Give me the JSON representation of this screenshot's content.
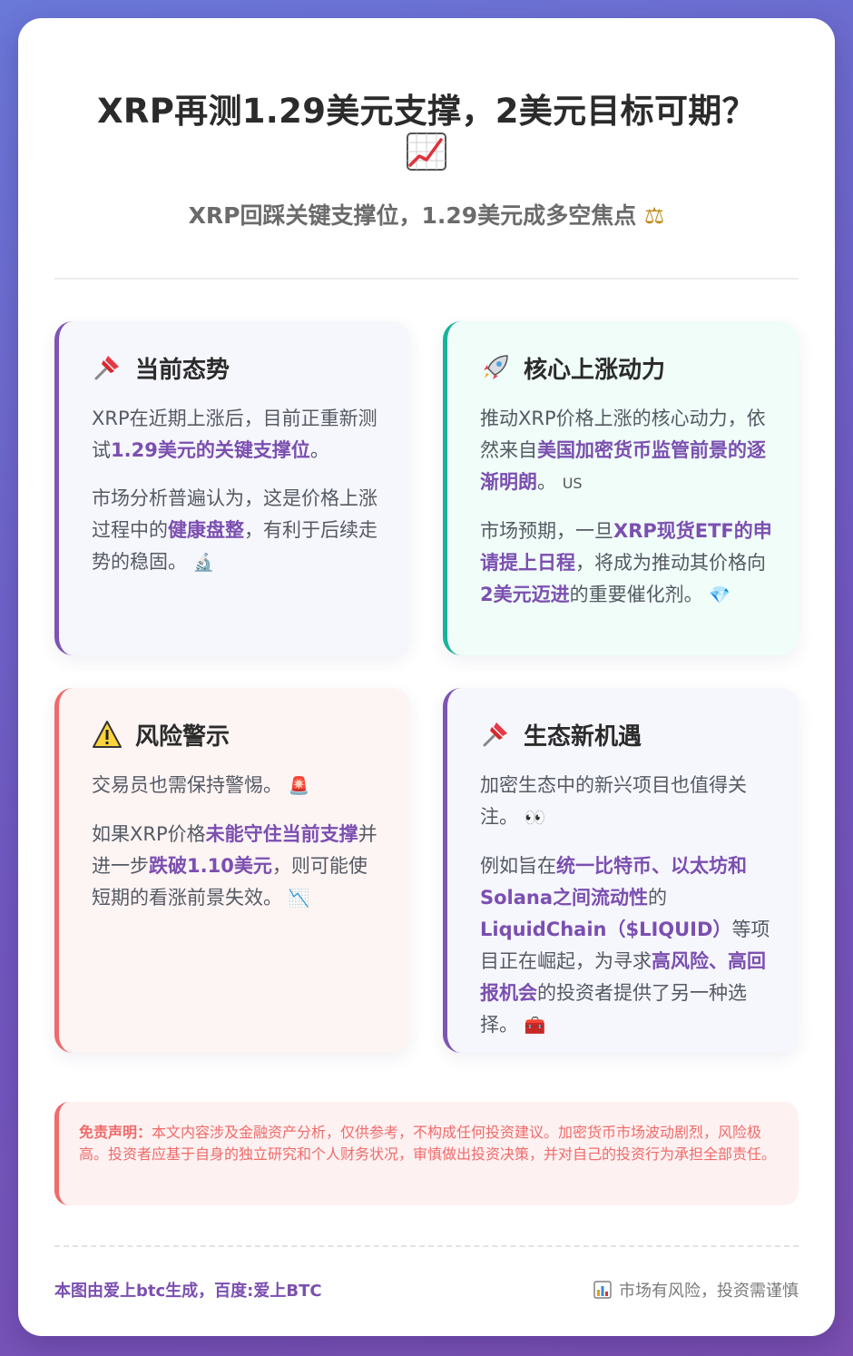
{
  "header": {
    "title": "XRP再测1.29美元支撑，2美元目标可期？",
    "title_icon": "chart-up-icon",
    "subtitle": "XRP回踩关键支撑位，1.29美元成多空焦点",
    "subtitle_icon": "balance-scale-icon"
  },
  "sections": {
    "current": {
      "icon": "pushpin-icon",
      "title": "当前态势",
      "p1_a": "XRP在近期上涨后，目前正重新测试",
      "p1_hl": "1.29美元的关键支撑位",
      "p1_b": "。",
      "p2_a": "市场分析普遍认为，这是价格上涨过程中的",
      "p2_hl": "健康盘整",
      "p2_b": "，有利于后续走势的稳固。",
      "p2_icon": "microscope-icon"
    },
    "drivers": {
      "icon": "rocket-icon",
      "title": "核心上涨动力",
      "p1_a": "推动XRP价格上涨的核心动力，依然来自",
      "p1_hl": "美国加密货币监管前景的逐渐明朗",
      "p1_b": "。",
      "p1_flag": "US",
      "p2_a": "市场预期，一旦",
      "p2_hl1": "XRP现货ETF的申请提上日程",
      "p2_b": "，将成为推动其价格向",
      "p2_hl2": "2美元迈进",
      "p2_c": "的重要催化剂。",
      "p2_icon": "gem-icon"
    },
    "risk": {
      "icon": "warning-icon",
      "title": "风险警示",
      "p1_a": "交易员也需保持警惕。",
      "p1_icon": "siren-icon",
      "p2_a": "如果XRP价格",
      "p2_hl1": "未能守住当前支撑",
      "p2_b": "并进一步",
      "p2_hl2": "跌破1.10美元",
      "p2_c": "，则可能使短期的看涨前景失效。",
      "p2_icon": "chart-down-icon"
    },
    "ecosystem": {
      "icon": "pushpin-icon",
      "title": "生态新机遇",
      "p1_a": "加密生态中的新兴项目也值得关注。",
      "p1_icon": "eyes-icon",
      "p2_a": "例如旨在",
      "p2_hl1": "统一比特币、以太坊和Solana之间流动性",
      "p2_b": "的",
      "p2_hl2": "LiquidChain（$LIQUID）",
      "p2_c": "等项目正在崛起，为寻求",
      "p2_hl3": "高风险、高回报机会",
      "p2_d": "的投资者提供了另一种选择。",
      "p2_icon": "toolbox-icon"
    }
  },
  "disclaimer": {
    "label": "免责声明：",
    "text": "本文内容涉及金融资产分析，仅供参考，不构成任何投资建议。加密货币市场波动剧烈，风险极高。投资者应基于自身的独立研究和个人财务状况，审慎做出投资决策，并对自己的投资行为承担全部责任。"
  },
  "footer": {
    "left": "本图由爱上btc生成，百度:爱上BTC",
    "right": "市场有风险，投资需谨慎",
    "right_icon": "bar-chart-icon"
  },
  "colors": {
    "accent_purple": "#7b4fb0",
    "accent_teal": "#17b49a",
    "accent_red": "#f06b6b"
  }
}
